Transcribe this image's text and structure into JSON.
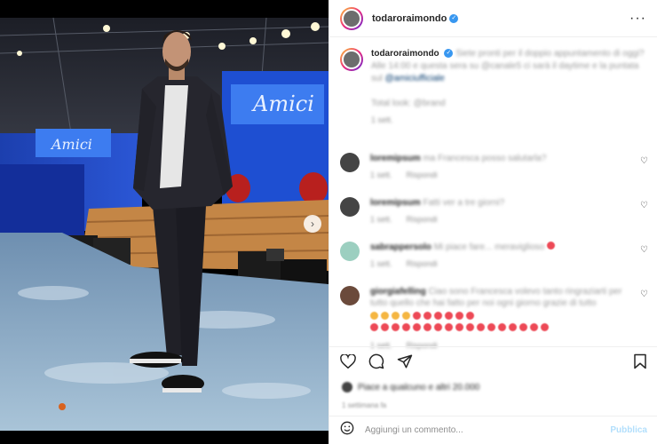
{
  "post": {
    "username": "todaroraimondo",
    "verified": true,
    "more_icon": "more-horizontal-icon"
  },
  "caption": {
    "username": "todaroraimondo",
    "line1": "Siete pronti per il doppio appuntamento di oggi?",
    "line2": "Alle 14:00 e questa sera su @canale5 ci sarà il daytime e la puntata sul",
    "line3": "@amiciufficiale",
    "line4": "Total look: @brand",
    "time": "1 sett."
  },
  "comments": [
    {
      "user": "loremipsum",
      "text": "ma Francesca posso salutarla?",
      "time": "1 sett.",
      "reply": "Rispondi"
    },
    {
      "user": "loremipsum",
      "text": "Fatti ver a tre giorni?",
      "time": "1 sett.",
      "reply": "Rispondi"
    },
    {
      "user": "sabrappersolo",
      "text": "Mi piace fare... meraviglioso",
      "time": "1 sett.",
      "reply": "Rispondi"
    },
    {
      "user": "giorgiafelling",
      "text": "Ciao sono Francesca volevo tanto ringraziarti per tutto quello che hai fatto per noi ogni giorno grazie di tutto",
      "time": "1 sett.",
      "reply": "Rispondi"
    }
  ],
  "likes": {
    "text": "Piace a qualcuno e altri 20.000"
  },
  "date": "1 settimana fa",
  "composer": {
    "placeholder": "Aggiungi un commento...",
    "publish": "Pubblica"
  },
  "photo": {
    "stage_sign": "Amici"
  }
}
